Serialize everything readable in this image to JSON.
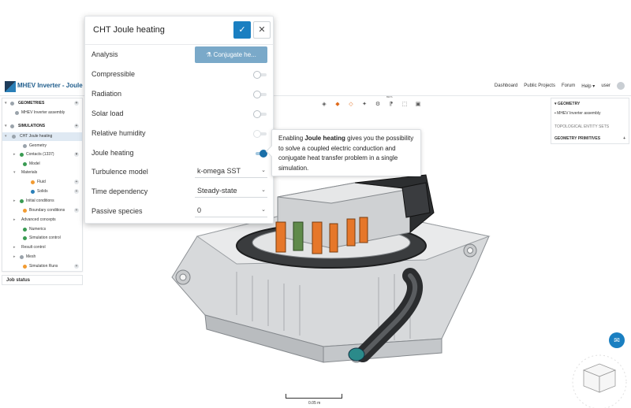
{
  "header": {
    "project_title": "MHEV Inverter - Joule heatin",
    "nav": [
      "Dashboard",
      "Public Projects",
      "Forum",
      "Help ▾"
    ],
    "user": "user"
  },
  "tree": {
    "geometries_label": "GEOMETRIES",
    "geometry_item": "MHEV Inverter assembly",
    "simulations_label": "SIMULATIONS",
    "simulation_item": "CHT Joule heating",
    "children": [
      "Geometry",
      "Contacts (1337)",
      "Model",
      "Materials",
      "Fluid",
      "Solids",
      "Initial conditions",
      "Boundary conditions",
      "Advanced concepts",
      "Numerics",
      "Simulation control",
      "Result control",
      "Mesh",
      "Simulation Runs"
    ]
  },
  "job_status": "Job status",
  "right_panel": {
    "geometry_label": "GEOMETRY",
    "geometry_item": "MHEV Inverter assembly",
    "topo_label": "TOPOLOGICAL ENTITY SETS",
    "primitives_label": "GEOMETRY PRIMITIVES"
  },
  "toolbar": {
    "icons": [
      "cube-view-icon",
      "orange-cube-icon",
      "section-cube-icon",
      "explode-icon",
      "settings-icon",
      "pointer-icon",
      "select-box-icon",
      "screenshot-icon"
    ],
    "beta_label": "BETA"
  },
  "dialog": {
    "title": "CHT Joule heating",
    "analysis_label": "Analysis",
    "analysis_value": "Conjugate he...",
    "compressible_label": "Compressible",
    "radiation_label": "Radiation",
    "solar_load_label": "Solar load",
    "relative_humidity_label": "Relative humidity",
    "joule_heating_label": "Joule heating",
    "turbulence_label": "Turbulence model",
    "turbulence_value": "k-omega SST",
    "time_label": "Time dependency",
    "time_value": "Steady-state",
    "passive_label": "Passive species",
    "passive_value": "0",
    "toggles": {
      "compressible": false,
      "radiation": false,
      "solar_load": false,
      "relative_humidity": false,
      "joule_heating": true
    }
  },
  "tooltip": {
    "prefix": "Enabling ",
    "bold": "Joule heating",
    "suffix": " gives you the possibility to solve a coupled electric conduction and conjugate heat transfer problem in a single simulation."
  },
  "scale_label": "0.05 m",
  "colors": {
    "primary": "#1a7fc1",
    "analysis_button": "#7aa9c9",
    "status_ok": "#3a9b53",
    "status_warn": "#f29b32"
  }
}
